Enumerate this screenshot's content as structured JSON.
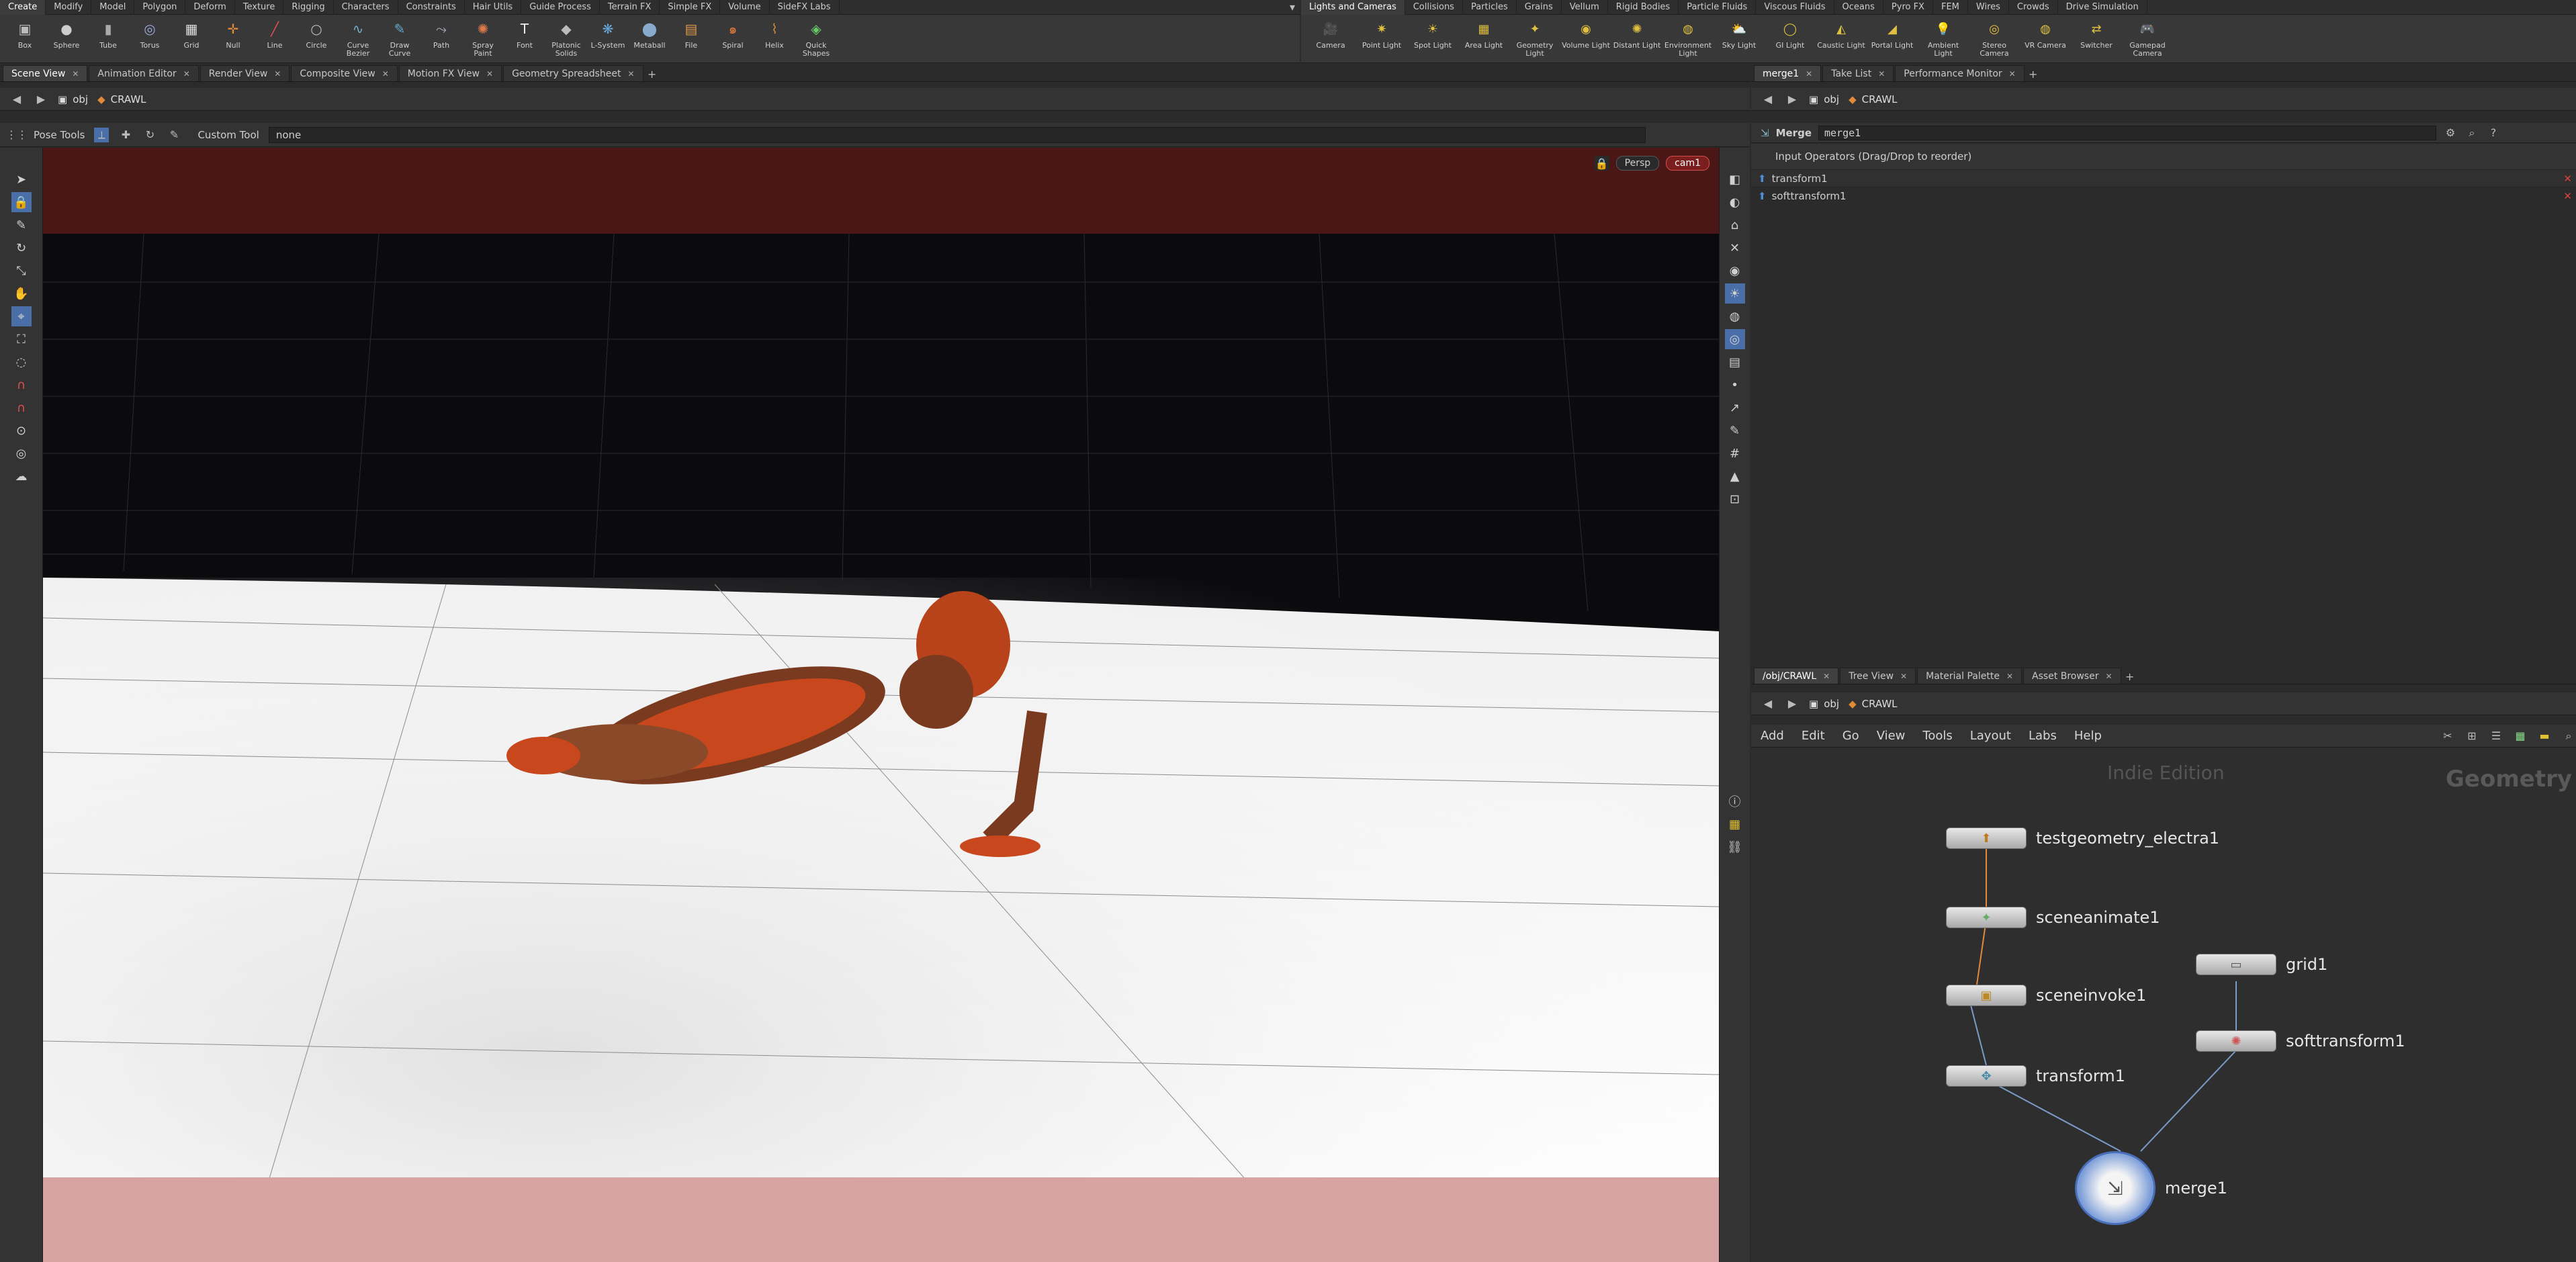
{
  "left_shelf": {
    "tabs": [
      "Create",
      "Modify",
      "Model",
      "Polygon",
      "Deform",
      "Texture",
      "Rigging",
      "Characters",
      "Constraints",
      "Hair Utils",
      "Guide Process",
      "Terrain FX",
      "Simple FX",
      "Volume",
      "SideFX Labs"
    ],
    "tools": [
      {
        "label": "Box",
        "icon": "box-icon"
      },
      {
        "label": "Sphere",
        "icon": "sphere-icon"
      },
      {
        "label": "Tube",
        "icon": "tube-icon"
      },
      {
        "label": "Torus",
        "icon": "torus-icon"
      },
      {
        "label": "Grid",
        "icon": "grid-icon"
      },
      {
        "label": "Null",
        "icon": "null-icon"
      },
      {
        "label": "Line",
        "icon": "line-icon"
      },
      {
        "label": "Circle",
        "icon": "circle-icon"
      },
      {
        "label": "Curve Bezier",
        "icon": "curve-bezier-icon"
      },
      {
        "label": "Draw Curve",
        "icon": "draw-curve-icon"
      },
      {
        "label": "Path",
        "icon": "path-icon"
      },
      {
        "label": "Spray Paint",
        "icon": "spray-paint-icon"
      },
      {
        "label": "Font",
        "icon": "font-icon"
      },
      {
        "label": "Platonic Solids",
        "icon": "platonic-icon"
      },
      {
        "label": "L-System",
        "icon": "lsystem-icon"
      },
      {
        "label": "Metaball",
        "icon": "metaball-icon"
      },
      {
        "label": "File",
        "icon": "file-icon"
      },
      {
        "label": "Spiral",
        "icon": "spiral-icon"
      },
      {
        "label": "Helix",
        "icon": "helix-icon"
      },
      {
        "label": "Quick Shapes",
        "icon": "quick-shapes-icon"
      }
    ]
  },
  "right_shelf": {
    "tabs": [
      "Lights and Cameras",
      "Collisions",
      "Particles",
      "Grains",
      "Vellum",
      "Rigid Bodies",
      "Particle Fluids",
      "Viscous Fluids",
      "Oceans",
      "Pyro FX",
      "FEM",
      "Wires",
      "Crowds",
      "Drive Simulation"
    ],
    "tools": [
      {
        "label": "Camera"
      },
      {
        "label": "Point Light"
      },
      {
        "label": "Spot Light"
      },
      {
        "label": "Area Light"
      },
      {
        "label": "Geometry Light"
      },
      {
        "label": "Volume Light"
      },
      {
        "label": "Distant Light"
      },
      {
        "label": "Environment Light"
      },
      {
        "label": "Sky Light"
      },
      {
        "label": "GI Light"
      },
      {
        "label": "Caustic Light"
      },
      {
        "label": "Portal Light"
      },
      {
        "label": "Ambient Light"
      },
      {
        "label": "Stereo Camera"
      },
      {
        "label": "VR Camera"
      },
      {
        "label": "Switcher"
      },
      {
        "label": "Gamepad Camera"
      }
    ]
  },
  "viewer": {
    "tabs": [
      "Scene View",
      "Animation Editor",
      "Render View",
      "Composite View",
      "Motion FX View",
      "Geometry Spreadsheet"
    ],
    "path": {
      "context": "obj",
      "object": "CRAWL"
    },
    "toolbar": {
      "pose_tools": "Pose Tools",
      "custom_tool_label": "Custom Tool",
      "custom_tool_value": "none"
    },
    "overlay": {
      "view": "Persp",
      "camera": "cam1"
    }
  },
  "params": {
    "tabs": [
      "merge1",
      "Take List",
      "Performance Monitor"
    ],
    "path": {
      "context": "obj",
      "object": "CRAWL"
    },
    "node_type": "Merge",
    "node_name": "merge1",
    "input_header": "Input Operators (Drag/Drop to reorder)",
    "inputs": [
      "transform1",
      "softtransform1"
    ]
  },
  "network": {
    "tabs": [
      "/obj/CRAWL",
      "Tree View",
      "Material Palette",
      "Asset Browser"
    ],
    "path": {
      "context": "obj",
      "object": "CRAWL"
    },
    "menu": [
      "Add",
      "Edit",
      "Go",
      "View",
      "Tools",
      "Layout",
      "Labs",
      "Help"
    ],
    "watermark": "Indie Edition",
    "context_label": "Geometry",
    "nodes": [
      {
        "name": "testgeometry_electra1"
      },
      {
        "name": "sceneanimate1"
      },
      {
        "name": "sceneinvoke1"
      },
      {
        "name": "transform1"
      },
      {
        "name": "grid1"
      },
      {
        "name": "softtransform1"
      },
      {
        "name": "merge1"
      }
    ]
  },
  "colors": {
    "accent": "#b33a3a",
    "bg": "#2b2b2b",
    "floor": "#f2f2f2",
    "sky": "#0b0b0d",
    "robot": "#c8471c"
  }
}
